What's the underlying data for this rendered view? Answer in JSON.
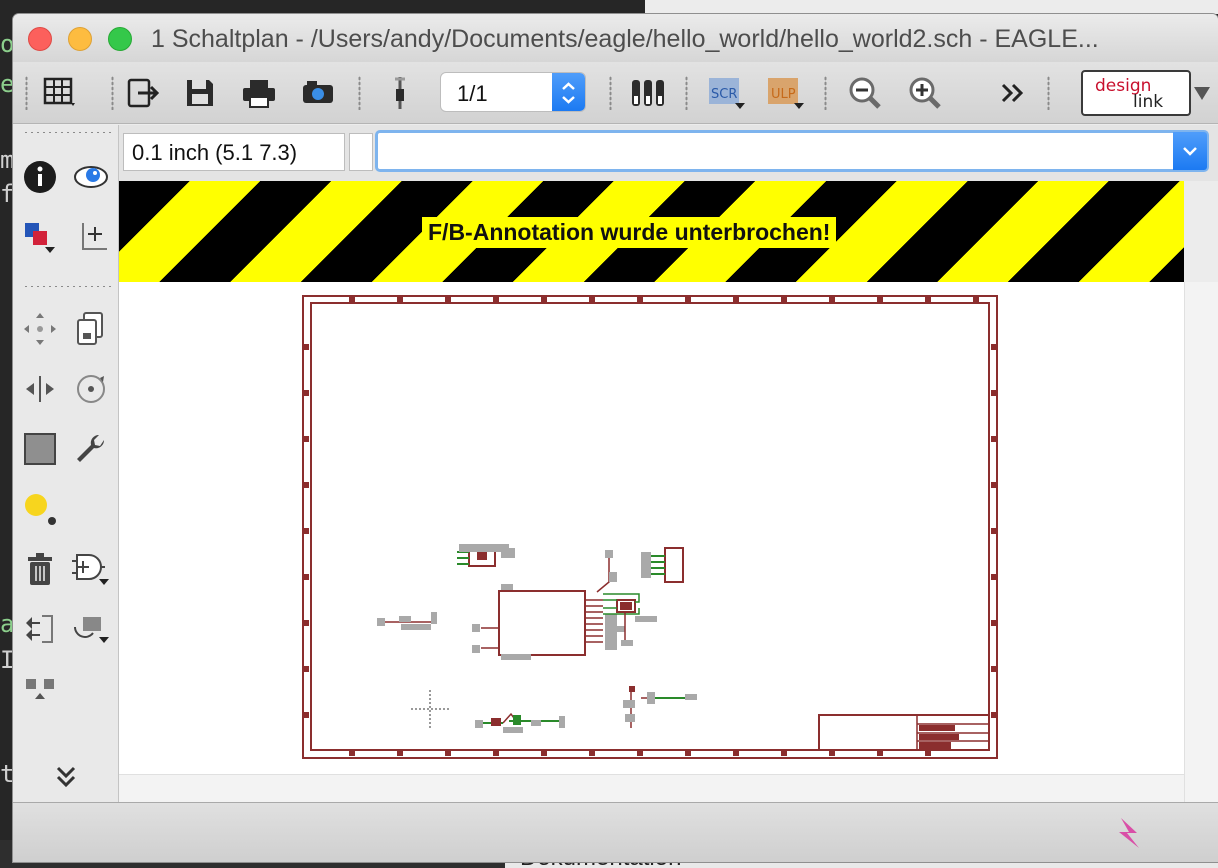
{
  "window": {
    "title": "1 Schaltplan - /Users/andy/Documents/eagle/hello_world/hello_world2.sch - EAGLE..."
  },
  "toolbar": {
    "page_value": "1/1",
    "buttons": [
      "grid",
      "export",
      "save",
      "print",
      "cam",
      "part",
      "page-select",
      "layers",
      "script",
      "ulp",
      "zoom-out",
      "zoom-in",
      "more",
      "design-link"
    ],
    "design_link_line1": "design",
    "design_link_line2": "link"
  },
  "commandbar": {
    "coordinates": "0.1 inch (5.1 7.3)",
    "command_value": "",
    "command_placeholder": ""
  },
  "banner": {
    "text": "F/B-Annotation wurde unterbrochen!",
    "colors": {
      "stripe_dark": "#000000",
      "stripe_light": "#ffff00"
    }
  },
  "palette": {
    "tools": [
      "info",
      "show",
      "display-layers",
      "mark",
      "move",
      "copy",
      "mirror",
      "rotate",
      "group",
      "change",
      "smash",
      "delete",
      "add",
      "replace",
      "gateswap",
      "split"
    ]
  },
  "background": {
    "bottom_text": "Dokumentation",
    "left_chars": [
      "o",
      "e",
      "m",
      "f",
      "a",
      "I",
      "t"
    ]
  },
  "colors": {
    "frame": "#8b2e2e",
    "net": "#2a8a2a",
    "accent": "#1c7af2"
  }
}
